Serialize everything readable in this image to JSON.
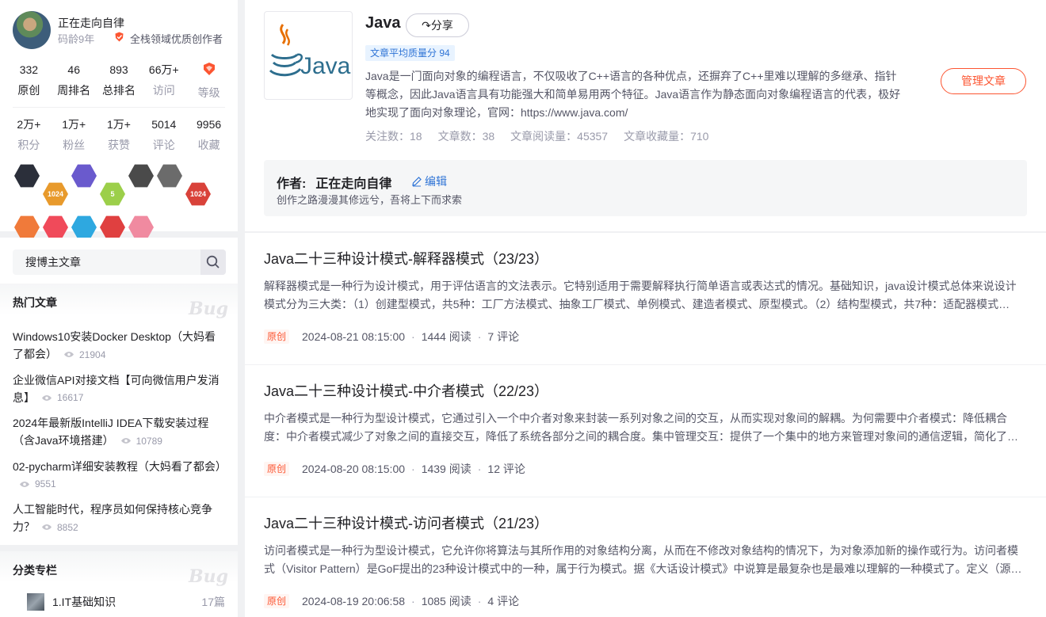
{
  "profile": {
    "username": "正在走向自律",
    "codeage": "码龄9年",
    "cert_text": "全栈领域优质创作者",
    "stats_row1": [
      {
        "num": "332",
        "label": "原创"
      },
      {
        "num": "46",
        "label": "周排名"
      },
      {
        "num": "893",
        "label": "总排名"
      },
      {
        "num": "66万+",
        "label": "访问"
      },
      {
        "num": "",
        "label": "等级"
      }
    ],
    "stats_row2": [
      {
        "num": "2万+",
        "label": "积分"
      },
      {
        "num": "1万+",
        "label": "粉丝"
      },
      {
        "num": "1万+",
        "label": "获赞"
      },
      {
        "num": "5014",
        "label": "评论"
      },
      {
        "num": "9956",
        "label": "收藏"
      }
    ],
    "badges": [
      {
        "icon": "rocket-badge-icon",
        "color": "#2b2f3a",
        "text": ""
      },
      {
        "icon": "1024-gold-badge-icon",
        "color": "#e89a2c",
        "text": "1024"
      },
      {
        "icon": "anniversary-badge-icon",
        "color": "#6a5acd",
        "text": ""
      },
      {
        "icon": "5-year-badge-icon",
        "color": "#9ccf4a",
        "text": "5"
      },
      {
        "icon": "column-badge-icon",
        "color": "#4a4a4a",
        "text": ""
      },
      {
        "icon": "github-badge-icon",
        "color": "#6b6b6b",
        "text": ""
      },
      {
        "icon": "1024-red-badge-icon",
        "color": "#d9423a",
        "text": "1024"
      },
      {
        "icon": "rich-content-badge-icon",
        "color": "#f07a3a",
        "text": ""
      },
      {
        "icon": "fox-badge-icon",
        "color": "#f04a5a",
        "text": ""
      },
      {
        "icon": "qa-badge-icon",
        "color": "#2ea8e0",
        "text": ""
      },
      {
        "icon": "pen-badge-icon",
        "color": "#e04040",
        "text": ""
      },
      {
        "icon": "mascot-badge-icon",
        "color": "#f08aa0",
        "text": ""
      }
    ]
  },
  "search": {
    "placeholder": "搜博主文章"
  },
  "hot_articles": {
    "title": "热门文章",
    "watermark": "Bug",
    "items": [
      {
        "title": "Windows10安装Docker Desktop（大妈看了都会）",
        "views": "21904"
      },
      {
        "title": "企业微信API对接文档【可向微信用户发消息】",
        "views": "16617"
      },
      {
        "title": "2024年最新版IntelliJ IDEA下载安装过程（含Java环境搭建）",
        "views": "10789"
      },
      {
        "title": "02-pycharm详细安装教程（大妈看了都会）",
        "views": "9551"
      },
      {
        "title": "人工智能时代，程序员如何保持核心竞争力？",
        "views": "8852"
      }
    ]
  },
  "categories": {
    "title": "分类专栏",
    "watermark": "Bug",
    "items": [
      {
        "label": "1.IT基础知识",
        "count": "17篇"
      }
    ]
  },
  "column": {
    "title": "Java",
    "share_label": "分享",
    "quality": "文章平均质量分 94",
    "description": "Java是一门面向对象的编程语言，不仅吸收了C++语言的各种优点，还摒弃了C++里难以理解的多继承、指针等概念，因此Java语言具有功能强大和简单易用两个特征。Java语言作为静态面向对象编程语言的代表，极好地实现了面向对象理论，官网：https://www.java.com/",
    "meta": [
      "关注数：18",
      "文章数：38",
      "文章阅读量：45357",
      "文章收藏量：710"
    ],
    "manage_label": "管理文章",
    "author_prefix": "作者:",
    "author_name": "正在走向自律",
    "edit_label": "编辑",
    "motto": "创作之路漫漫其修远兮，吾将上下而求索",
    "cover_text": "Java"
  },
  "articles": [
    {
      "title": "Java二十三种设计模式-解释器模式（23/23）",
      "summary": "解释器模式是一种行为设计模式，用于评估语言的文法表示。它特别适用于需要解释执行简单语言或表达式的情况。基础知识，java设计模式总体来说设计模式分为三大类：（1）创建型模式，共5种：工厂方法模式、抽象工厂模式、单例模式、建造者模式、原型模式。（2）结构型模式，共7种：适配器模式…",
      "tag": "原创",
      "date": "2024-08-21 08:15:00",
      "reads": "1444 阅读",
      "comments": "7 评论"
    },
    {
      "title": "Java二十三种设计模式-中介者模式（22/23）",
      "summary": "中介者模式是一种行为型设计模式，它通过引入一个中介者对象来封装一系列对象之间的交互，从而实现对象间的解耦。为何需要中介者模式：降低耦合度：中介者模式减少了对象之间的直接交互，降低了系统各部分之间的耦合度。集中管理交互：提供了一个集中的地方来管理对象间的通信逻辑，简化了…",
      "tag": "原创",
      "date": "2024-08-20 08:15:00",
      "reads": "1439 阅读",
      "comments": "12 评论"
    },
    {
      "title": "Java二十三种设计模式-访问者模式（21/23）",
      "summary": "访问者模式是一种行为型设计模式，它允许你将算法与其所作用的对象结构分离，从而在不修改对象结构的情况下，为对象添加新的操作或行为。访问者模式（Visitor Pattern）是GoF提出的23种设计模式中的一种，属于行为模式。据《大话设计模式》中说算是最复杂也是最难以理解的一种模式了。定义（源…",
      "tag": "原创",
      "date": "2024-08-19 20:06:58",
      "reads": "1085 阅读",
      "comments": "4 评论"
    }
  ]
}
